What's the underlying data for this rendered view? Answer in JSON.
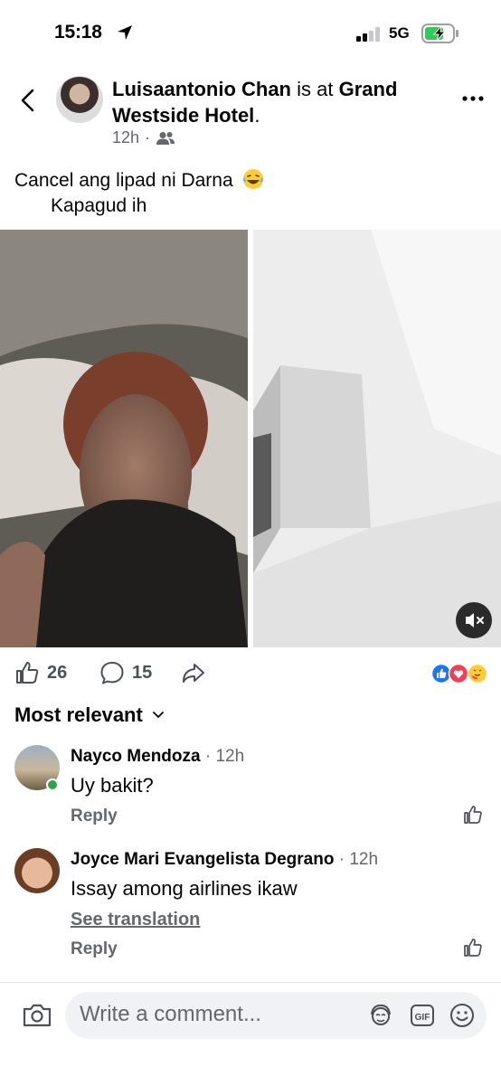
{
  "status_bar": {
    "time": "15:18",
    "network": "5G"
  },
  "header": {
    "poster_name": "Luisaantonio Chan",
    "is_at": "is at",
    "place": "Grand Westside Hotel",
    "period": ".",
    "time_ago": "12h",
    "separator": "·",
    "audience_icon": "friends-icon"
  },
  "post": {
    "caption_line1": "Cancel ang lipad ni Darna",
    "caption_line2": "Kapagud ih",
    "caption_emoji": "laughing-tears-emoji"
  },
  "actions": {
    "likes": "26",
    "comments": "15"
  },
  "sort": {
    "label": "Most relevant"
  },
  "comments": [
    {
      "name": "Nayco Mendoza",
      "time": " · 12h",
      "text": "Uy bakit?",
      "reply": "Reply"
    },
    {
      "name": "Joyce Mari Evangelista Degrano",
      "time": " · 12h",
      "text": "Issay among airlines ikaw",
      "translate": "See translation",
      "reply": "Reply"
    }
  ],
  "composer": {
    "placeholder": "Write a comment..."
  },
  "colors": {
    "accent": "#1877f2",
    "secondary_text": "#65676b",
    "online": "#31a24c"
  }
}
